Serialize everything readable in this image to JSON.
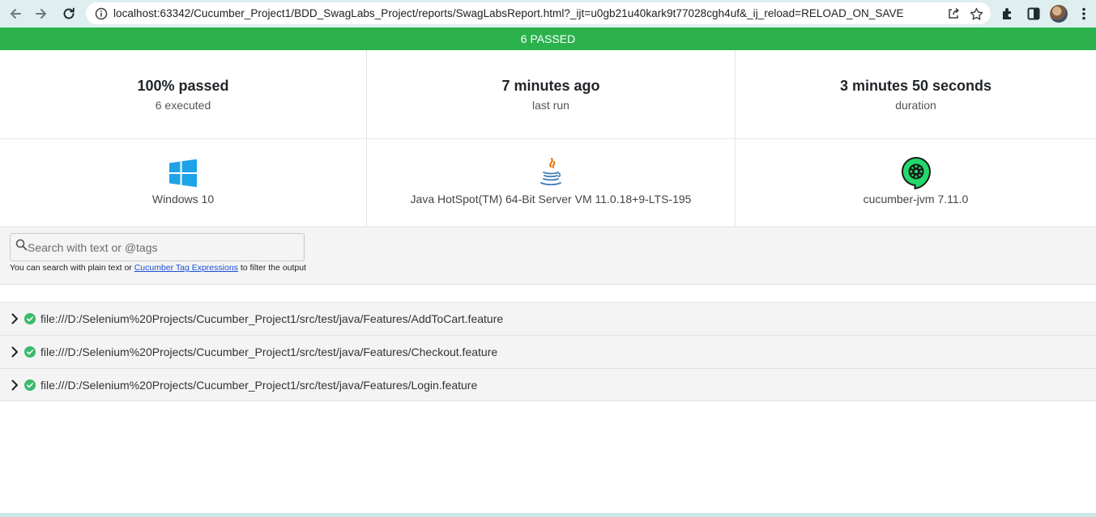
{
  "browser": {
    "url": "localhost:63342/Cucumber_Project1/BDD_SwagLabs_Project/reports/SwagLabsReport.html?_ijt=u0gb21u40kark9t77028cgh4uf&_ij_reload=RELOAD_ON_SAVE",
    "icons": [
      "back-arrow-icon",
      "forward-arrow-icon",
      "reload-icon",
      "info-icon",
      "share-icon",
      "star-icon",
      "extensions-icon",
      "side-panel-icon",
      "avatar",
      "kebab-menu-icon"
    ]
  },
  "status": {
    "label": "6 PASSED",
    "color": "#2bb24c"
  },
  "stats": {
    "passed": {
      "value": "100% passed",
      "label": "6 executed"
    },
    "last_run": {
      "value": "7 minutes ago",
      "label": "last run"
    },
    "duration": {
      "value": "3 minutes 50 seconds",
      "label": "duration"
    }
  },
  "environment": {
    "os": {
      "label": "Windows 10",
      "icon": "windows-icon"
    },
    "runtime": {
      "label": "Java HotSpot(TM) 64-Bit Server VM 11.0.18+9-LTS-195",
      "icon": "java-icon"
    },
    "tool": {
      "label": "cucumber-jvm 7.11.0",
      "icon": "cucumber-icon"
    }
  },
  "search": {
    "placeholder": "Search with text or @tags",
    "value": "",
    "help_prefix": "You can search with plain text or ",
    "help_link": "Cucumber Tag Expressions",
    "help_suffix": " to filter the output"
  },
  "features": [
    {
      "path": "file:///D:/Selenium%20Projects/Cucumber_Project1/src/test/java/Features/AddToCart.feature",
      "status": "passed"
    },
    {
      "path": "file:///D:/Selenium%20Projects/Cucumber_Project1/src/test/java/Features/Checkout.feature",
      "status": "passed"
    },
    {
      "path": "file:///D:/Selenium%20Projects/Cucumber_Project1/src/test/java/Features/Login.feature",
      "status": "passed"
    }
  ],
  "colors": {
    "passed": "#2bb24c",
    "pass_icon": "#3cba6e",
    "link": "#1a4fd6"
  }
}
